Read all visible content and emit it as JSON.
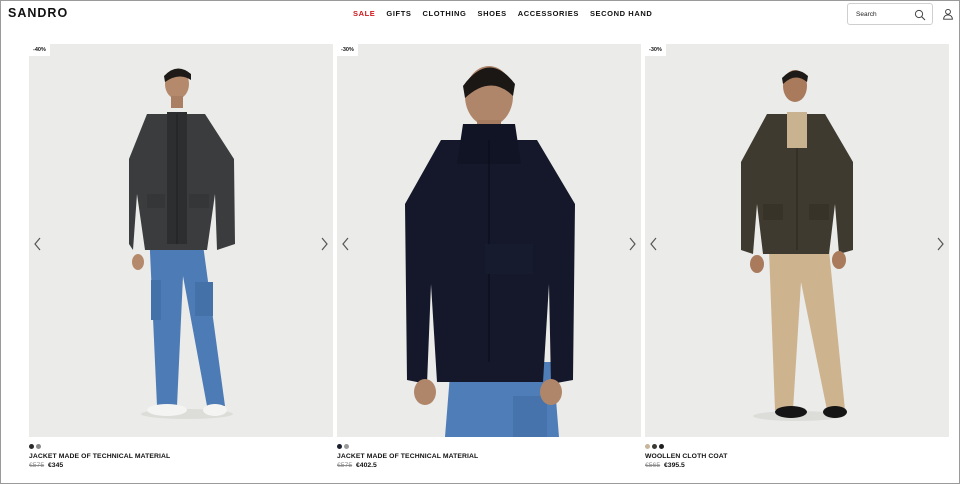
{
  "brand": {
    "logo": "SANDRO"
  },
  "nav": {
    "items": [
      "SALE",
      "GIFTS",
      "CLOTHING",
      "SHOES",
      "ACCESSORIES",
      "SECOND HAND"
    ]
  },
  "search": {
    "placeholder": "Search"
  },
  "icons": {
    "search": "search-icon",
    "account": "user-icon",
    "prev": "chevron-left-icon",
    "next": "chevron-right-icon"
  },
  "colors": {
    "sale": "#d0161b",
    "text": "#111111",
    "old_price": "#8a8a8a"
  },
  "products": [
    {
      "badge": "-40%",
      "name": "JACKET MADE OF TECHNICAL MATERIAL",
      "old_price": "€575",
      "price": "€345",
      "swatches": [
        "#2b2b2b",
        "#8a8a8a"
      ]
    },
    {
      "badge": "-30%",
      "name": "JACKET MADE OF TECHNICAL MATERIAL",
      "old_price": "€575",
      "price": "€402.5",
      "swatches": [
        "#1a1f2e",
        "#9a9a9a"
      ]
    },
    {
      "badge": "-30%",
      "name": "WOOLLEN CLOTH COAT",
      "old_price": "€565",
      "price": "€395.5",
      "swatches": [
        "#c8b59a",
        "#3a3a32",
        "#1f1f1f"
      ]
    }
  ]
}
